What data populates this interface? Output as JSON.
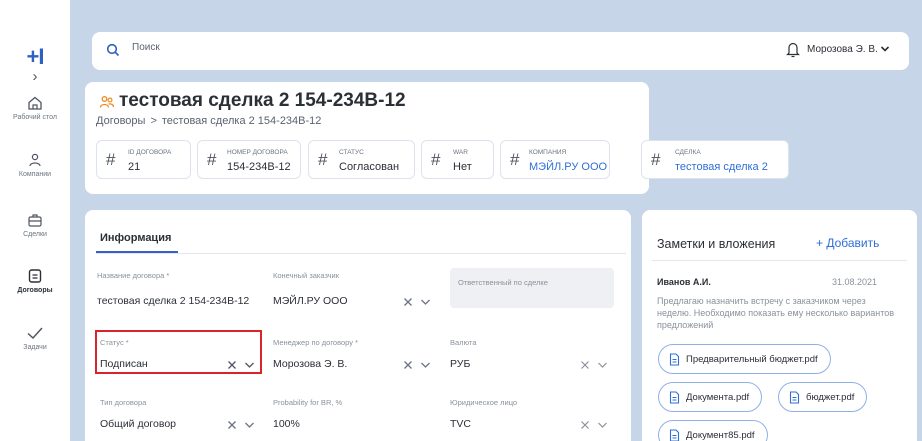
{
  "sidebar": {
    "logo": "+I",
    "items": [
      {
        "label": "Рабочий стол"
      },
      {
        "label": "Компании"
      },
      {
        "label": "Сделки"
      },
      {
        "label": "Договоры"
      },
      {
        "label": "Задачи"
      }
    ]
  },
  "topbar": {
    "search_placeholder": "Поиск",
    "user_name": "Морозова Э. В."
  },
  "header": {
    "title": "тестовая сделка 2 154-234B-12",
    "breadcrumb": [
      "Договоры",
      "тестовая сделка 2 154-234B-12"
    ],
    "fields": [
      {
        "label": "ID ДОГОВОРА",
        "value": "21"
      },
      {
        "label": "НОМЕР ДОГОВОРА",
        "value": "154-234B-12"
      },
      {
        "label": "СТАТУС",
        "value": "Согласован"
      },
      {
        "label": "WAR",
        "value": "Нет"
      },
      {
        "label": "КОМПАНИЯ",
        "value": "МЭЙЛ.РУ ООО"
      },
      {
        "label": "СДЕЛКА",
        "value": "тестовая сделка 2"
      }
    ]
  },
  "info": {
    "tab": "Информация",
    "fields": {
      "contract_name": {
        "label": "Название договора *",
        "value": "тестовая сделка 2 154-234B-12"
      },
      "end_customer": {
        "label": "Конечный заказчик",
        "value": "МЭЙЛ.РУ ООО"
      },
      "responsible": {
        "label": "Ответственный по сделке"
      },
      "status": {
        "label": "Статус *",
        "value": "Подписан"
      },
      "manager": {
        "label": "Менеджер по договору *",
        "value": "Морозова Э. В."
      },
      "currency": {
        "label": "Валюта",
        "value": "РУБ"
      },
      "contract_type": {
        "label": "Тип договора",
        "value": "Общий договор"
      },
      "probability": {
        "label": "Probability for BR, %",
        "value": "100%"
      },
      "legal_entity": {
        "label": "Юридическое лицо",
        "value": "TVC"
      }
    }
  },
  "notes": {
    "title": "Заметки и вложения",
    "add_label": "+ Добавить",
    "note": {
      "author": "Иванов А.И.",
      "date": "31.08.2021",
      "text": "Предлагаю назначить встречу с заказчиком через неделю. Необходимо показать ему несколько вариантов предложений"
    },
    "attachments": [
      "Предварительный бюджет.pdf",
      "Документа.pdf",
      "бюджет.pdf",
      "Документ85.pdf"
    ]
  }
}
